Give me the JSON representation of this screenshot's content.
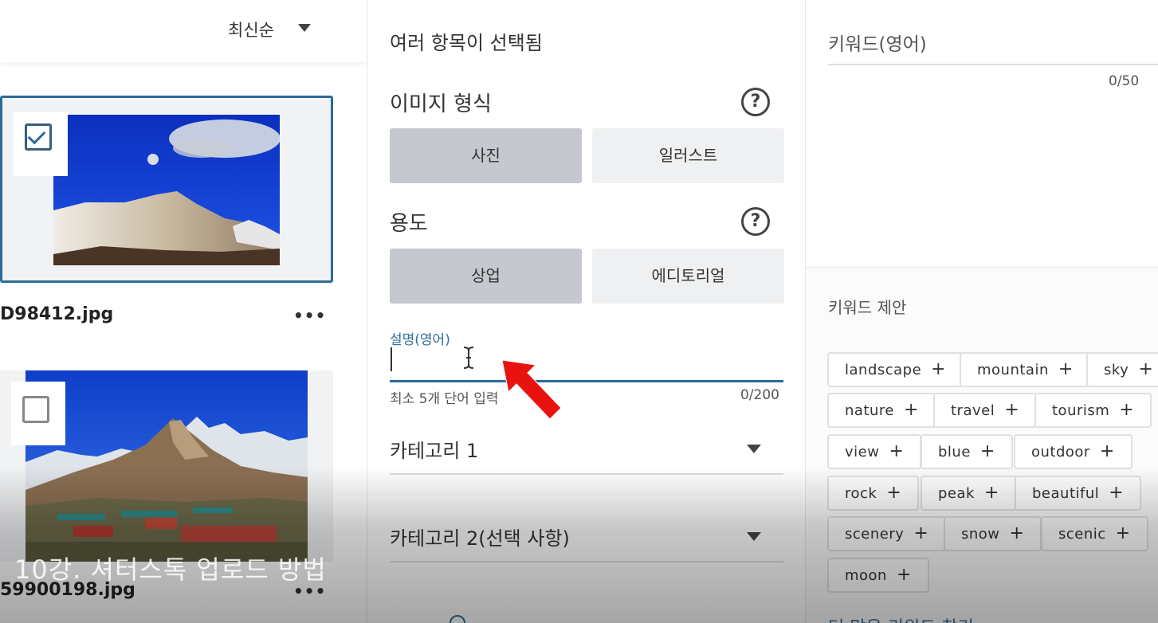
{
  "left": {
    "sort_label": "최신순",
    "files": [
      {
        "name": "D98412.jpg",
        "checked": true
      },
      {
        "name": "59900198.jpg",
        "checked": false
      }
    ],
    "more_actions_glyph": "•••"
  },
  "middle": {
    "title": "여러 항목이 선택됨",
    "image_type": {
      "label": "이미지 형식",
      "help_glyph": "?",
      "options": [
        "사진",
        "일러스트"
      ],
      "selected": "사진"
    },
    "usage": {
      "label": "용도",
      "help_glyph": "?",
      "options": [
        "상업",
        "에디토리얼"
      ],
      "selected": "상업"
    },
    "description": {
      "label": "설명(영어)",
      "value": "",
      "hint": "최소 5개 단어 입력",
      "counter": "0/200"
    },
    "category1": {
      "label": "카테고리 1"
    },
    "category2": {
      "label": "카테고리 2(선택 사항)"
    }
  },
  "right": {
    "keywords": {
      "label": "키워드(영어)",
      "counter": "0/50"
    },
    "suggestions": {
      "label": "키워드 제안",
      "chips": [
        "landscape",
        "mountain",
        "sky",
        "nature",
        "travel",
        "tourism",
        "view",
        "blue",
        "outdoor",
        "rock",
        "peak",
        "beautiful",
        "scenery",
        "snow",
        "scenic",
        "moon"
      ],
      "more_link": "더 많은 키워드 찾기"
    }
  },
  "overlay": {
    "caption": "10강. 셔터스톡 업로드 방법",
    "annotation_color": "#e8130f"
  },
  "colors": {
    "accent": "#2b6b98",
    "selected_option": "#c5c8ce"
  }
}
